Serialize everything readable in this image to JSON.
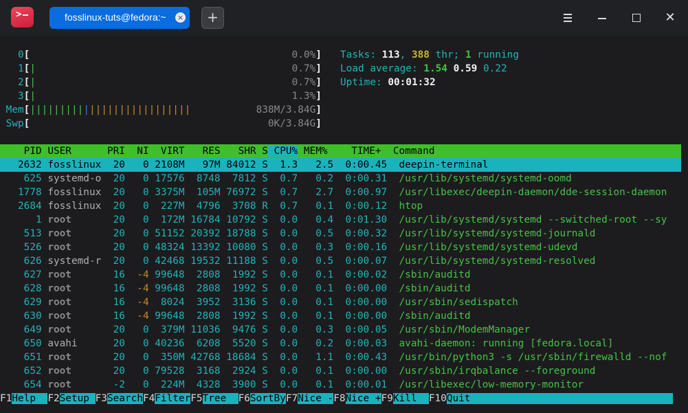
{
  "titlebar": {
    "tab_label": "fosslinux-tuts@fedora:~",
    "close_glyph": "×",
    "new_tab_glyph": "+",
    "icons": [
      "terminal-app-icon",
      "menu-icon",
      "minimize-icon",
      "maximize-icon",
      "close-icon"
    ]
  },
  "meters": {
    "cpus": [
      {
        "id": "0",
        "bar": "",
        "value": "0.0%"
      },
      {
        "id": "1",
        "bar": "|",
        "value": "0.7%"
      },
      {
        "id": "2",
        "bar": "|",
        "value": "0.7%"
      },
      {
        "id": "3",
        "bar": "|",
        "value": "1.3%"
      }
    ],
    "mem": {
      "label": "Mem",
      "bar_green": "|||||||||",
      "bar_blue": "|",
      "bar_orange": "|||||||||||||||||",
      "value": "838M/3.84G"
    },
    "swp": {
      "label": "Swp",
      "value": "0K/3.84G"
    }
  },
  "summary": {
    "tasks_label": "Tasks: ",
    "tasks": "113",
    "thr": "388",
    "thr_label": " thr; ",
    "running": "1",
    "running_label": " running",
    "load_label": "Load average: ",
    "load1": "1.54",
    "load5": "0.59",
    "load15": "0.22",
    "uptime_label": "Uptime: ",
    "uptime": "00:01:32"
  },
  "table": {
    "columns": [
      "PID",
      "USER",
      "PRI",
      "NI",
      "VIRT",
      "RES",
      "SHR",
      "S",
      "CPU%",
      "MEM%",
      "TIME+",
      "Command"
    ],
    "rows": [
      {
        "pid": "2632",
        "user": "fosslinux",
        "pri": "20",
        "ni": "0",
        "virt": "2108M",
        "res": "97M",
        "shr": "84012",
        "s": "S",
        "cpu": "1.3",
        "mem": "2.5",
        "time": "0:00.45",
        "cmd": "deepin-terminal"
      },
      {
        "pid": "625",
        "user": "systemd-o",
        "pri": "20",
        "ni": "0",
        "virt": "17576",
        "res": "8748",
        "shr": "7812",
        "s": "S",
        "cpu": "0.7",
        "mem": "0.2",
        "time": "0:00.31",
        "cmd": "/usr/lib/systemd/systemd-oomd"
      },
      {
        "pid": "1778",
        "user": "fosslinux",
        "pri": "20",
        "ni": "0",
        "virt": "3375M",
        "res": "105M",
        "shr": "76972",
        "s": "S",
        "cpu": "0.7",
        "mem": "2.7",
        "time": "0:00.97",
        "cmd": "/usr/libexec/deepin-daemon/dde-session-daemon"
      },
      {
        "pid": "2684",
        "user": "fosslinux",
        "pri": "20",
        "ni": "0",
        "virt": "227M",
        "res": "4796",
        "shr": "3708",
        "s": "R",
        "cpu": "0.7",
        "mem": "0.1",
        "time": "0:00.12",
        "cmd": "htop"
      },
      {
        "pid": "1",
        "user": "root",
        "pri": "20",
        "ni": "0",
        "virt": "172M",
        "res": "16784",
        "shr": "10792",
        "s": "S",
        "cpu": "0.0",
        "mem": "0.4",
        "time": "0:01.30",
        "cmd": "/usr/lib/systemd/systemd --switched-root --sy"
      },
      {
        "pid": "513",
        "user": "root",
        "pri": "20",
        "ni": "0",
        "virt": "51152",
        "res": "20392",
        "shr": "18788",
        "s": "S",
        "cpu": "0.0",
        "mem": "0.5",
        "time": "0:00.32",
        "cmd": "/usr/lib/systemd/systemd-journald"
      },
      {
        "pid": "526",
        "user": "root",
        "pri": "20",
        "ni": "0",
        "virt": "48324",
        "res": "13392",
        "shr": "10080",
        "s": "S",
        "cpu": "0.0",
        "mem": "0.3",
        "time": "0:00.16",
        "cmd": "/usr/lib/systemd/systemd-udevd"
      },
      {
        "pid": "626",
        "user": "systemd-r",
        "pri": "20",
        "ni": "0",
        "virt": "42468",
        "res": "19532",
        "shr": "11188",
        "s": "S",
        "cpu": "0.0",
        "mem": "0.5",
        "time": "0:00.07",
        "cmd": "/usr/lib/systemd/systemd-resolved"
      },
      {
        "pid": "627",
        "user": "root",
        "pri": "16",
        "ni": "-4",
        "virt": "99648",
        "res": "2808",
        "shr": "1992",
        "s": "S",
        "cpu": "0.0",
        "mem": "0.1",
        "time": "0:00.02",
        "cmd": "/sbin/auditd"
      },
      {
        "pid": "628",
        "user": "root",
        "pri": "16",
        "ni": "-4",
        "virt": "99648",
        "res": "2808",
        "shr": "1992",
        "s": "S",
        "cpu": "0.0",
        "mem": "0.1",
        "time": "0:00.00",
        "cmd": "/sbin/auditd"
      },
      {
        "pid": "629",
        "user": "root",
        "pri": "16",
        "ni": "-4",
        "virt": "8024",
        "res": "3952",
        "shr": "3136",
        "s": "S",
        "cpu": "0.0",
        "mem": "0.1",
        "time": "0:00.00",
        "cmd": "/usr/sbin/sedispatch"
      },
      {
        "pid": "630",
        "user": "root",
        "pri": "16",
        "ni": "-4",
        "virt": "99648",
        "res": "2808",
        "shr": "1992",
        "s": "S",
        "cpu": "0.0",
        "mem": "0.1",
        "time": "0:00.00",
        "cmd": "/sbin/auditd"
      },
      {
        "pid": "649",
        "user": "root",
        "pri": "20",
        "ni": "0",
        "virt": "379M",
        "res": "11036",
        "shr": "9476",
        "s": "S",
        "cpu": "0.0",
        "mem": "0.3",
        "time": "0:00.05",
        "cmd": "/usr/sbin/ModemManager"
      },
      {
        "pid": "650",
        "user": "avahi",
        "pri": "20",
        "ni": "0",
        "virt": "40236",
        "res": "6208",
        "shr": "5520",
        "s": "S",
        "cpu": "0.0",
        "mem": "0.2",
        "time": "0:00.03",
        "cmd": "avahi-daemon: running [fedora.local]"
      },
      {
        "pid": "651",
        "user": "root",
        "pri": "20",
        "ni": "0",
        "virt": "350M",
        "res": "42768",
        "shr": "18684",
        "s": "S",
        "cpu": "0.0",
        "mem": "1.1",
        "time": "0:00.43",
        "cmd": "/usr/bin/python3 -s /usr/sbin/firewalld --nof"
      },
      {
        "pid": "652",
        "user": "root",
        "pri": "20",
        "ni": "0",
        "virt": "79528",
        "res": "3168",
        "shr": "2924",
        "s": "S",
        "cpu": "0.0",
        "mem": "0.1",
        "time": "0:00.00",
        "cmd": "/usr/sbin/irqbalance --foreground"
      },
      {
        "pid": "654",
        "user": "root",
        "pri": "-2",
        "ni": "0",
        "virt": "224M",
        "res": "4328",
        "shr": "3900",
        "s": "S",
        "cpu": "0.0",
        "mem": "0.1",
        "time": "0:00.01",
        "cmd": "/usr/libexec/low-memory-monitor"
      }
    ]
  },
  "function_keys": [
    {
      "key": "F1",
      "label": "Help  "
    },
    {
      "key": "F2",
      "label": "Setup "
    },
    {
      "key": "F3",
      "label": "Search"
    },
    {
      "key": "F4",
      "label": "Filter"
    },
    {
      "key": "F5",
      "label": "Tree  "
    },
    {
      "key": "F6",
      "label": "SortBy"
    },
    {
      "key": "F7",
      "label": "Nice -"
    },
    {
      "key": "F8",
      "label": "Nice +"
    },
    {
      "key": "F9",
      "label": "Kill  "
    },
    {
      "key": "F10",
      "label": "Quit"
    }
  ],
  "colors": {
    "header_green": "#3fbf2a",
    "selection_cyan": "#1ab3bd",
    "tab_blue": "#0a6cde",
    "accent_red": "#e43a52"
  }
}
